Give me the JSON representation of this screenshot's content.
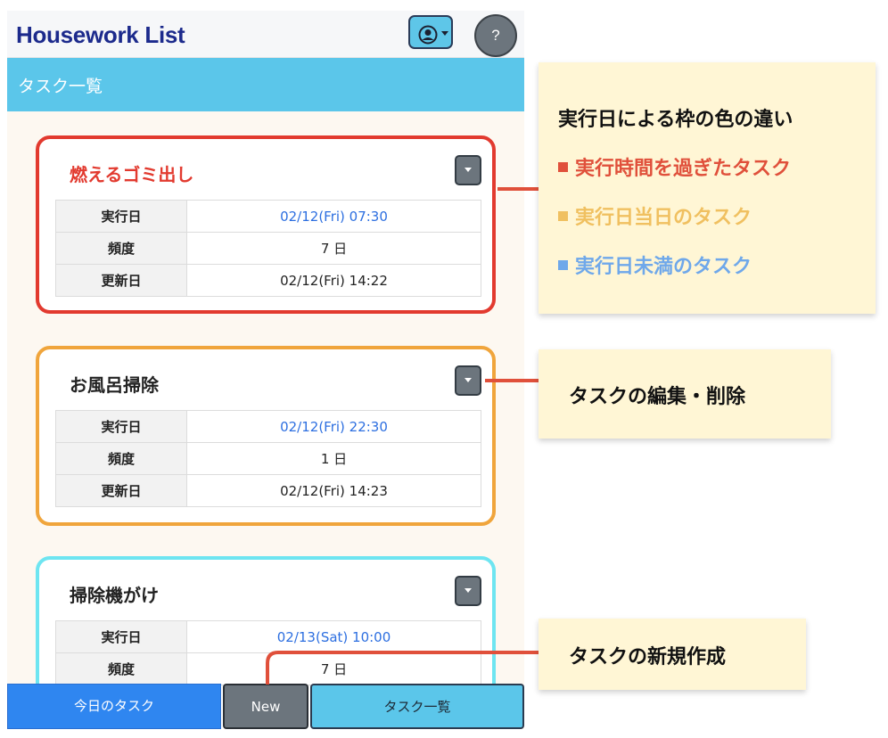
{
  "app": {
    "title": "Housework List",
    "page_title": "タスク一覧",
    "header_icons": [
      "user-circle-icon",
      "help-icon"
    ],
    "help_label": "?"
  },
  "tasks": [
    {
      "name": "燃えるゴミ出し",
      "status": "overdue",
      "rows": [
        {
          "label": "実行日",
          "value": "02/12(Fri) 07:30"
        },
        {
          "label": "頻度",
          "value": "7 日"
        },
        {
          "label": "更新日",
          "value": "02/12(Fri) 14:22"
        }
      ]
    },
    {
      "name": "お風呂掃除",
      "status": "today",
      "rows": [
        {
          "label": "実行日",
          "value": "02/12(Fri) 22:30"
        },
        {
          "label": "頻度",
          "value": "1 日"
        },
        {
          "label": "更新日",
          "value": "02/12(Fri) 14:23"
        }
      ]
    },
    {
      "name": "掃除機がけ",
      "status": "upcoming",
      "rows": [
        {
          "label": "実行日",
          "value": "02/13(Sat) 10:00"
        },
        {
          "label": "頻度",
          "value": "7 日"
        }
      ]
    }
  ],
  "bottom_nav": {
    "today": "今日のタスク",
    "new": "New",
    "list": "タスク一覧"
  },
  "annotations": {
    "legend_title": "実行日による枠の色の違い",
    "legend": [
      {
        "label": "実行時間を過ぎたタスク",
        "color": "#e0503b"
      },
      {
        "label": "実行日当日のタスク",
        "color": "#f0c060"
      },
      {
        "label": "実行日未満のタスク",
        "color": "#6fa8ea"
      }
    ],
    "edit_delete": "タスクの編集・削除",
    "new_task": "タスクの新規作成"
  },
  "colors": {
    "overdue": "#e23a2f",
    "today": "#f0a53c",
    "upcoming": "#6ee5f1",
    "link_date": "#2d6fe0",
    "header_bar": "#5bc6ea",
    "callout_line": "#e0503b"
  }
}
